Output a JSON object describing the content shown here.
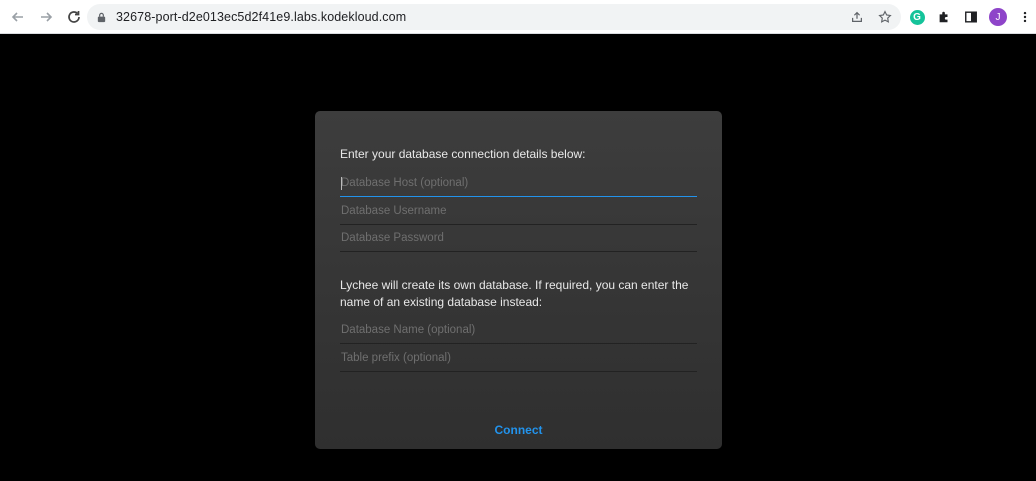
{
  "browser": {
    "url": "32678-port-d2e013ec5d2f41e9.labs.kodekloud.com",
    "grammarly_letter": "G",
    "avatar_letter": "J"
  },
  "dialog": {
    "intro_text": "Enter your database connection details below:",
    "fields_top": [
      {
        "placeholder": "Database Host (optional)"
      },
      {
        "placeholder": "Database Username"
      },
      {
        "placeholder": "Database Password"
      }
    ],
    "info_text": "Lychee will create its own database. If required, you can enter the name of an existing database instead:",
    "fields_bottom": [
      {
        "placeholder": "Database Name (optional)"
      },
      {
        "placeholder": "Table prefix (optional)"
      }
    ],
    "connect_label": "Connect",
    "accent_color": "#2293ec"
  }
}
